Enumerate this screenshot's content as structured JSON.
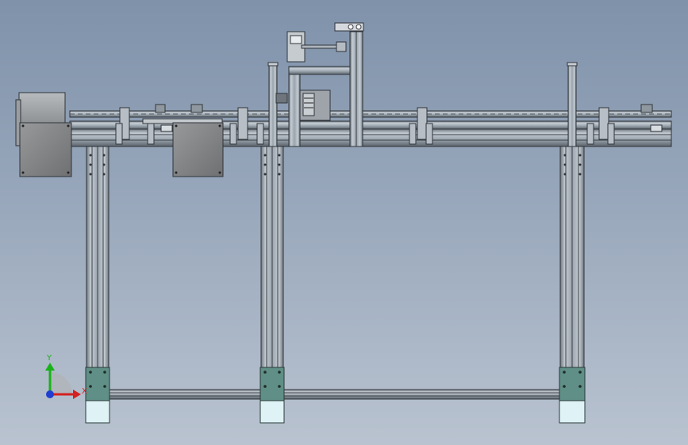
{
  "viewport": {
    "background_top": "#7f92aa",
    "background_bottom": "#b9c3d0"
  },
  "model": {
    "profile_color": "#aab4be",
    "profile_dark": "#3a3f45",
    "plate_color": "#8a8c8e",
    "foot_color": "#5f8f86",
    "foot_pad_color": "#dff3f6"
  },
  "triad": {
    "x_label": "X",
    "y_label": "Y",
    "x_color": "#d42020",
    "y_color": "#19b219",
    "z_color": "#1f3fd0"
  },
  "icons": [
    "coordinate-triad-icon"
  ]
}
